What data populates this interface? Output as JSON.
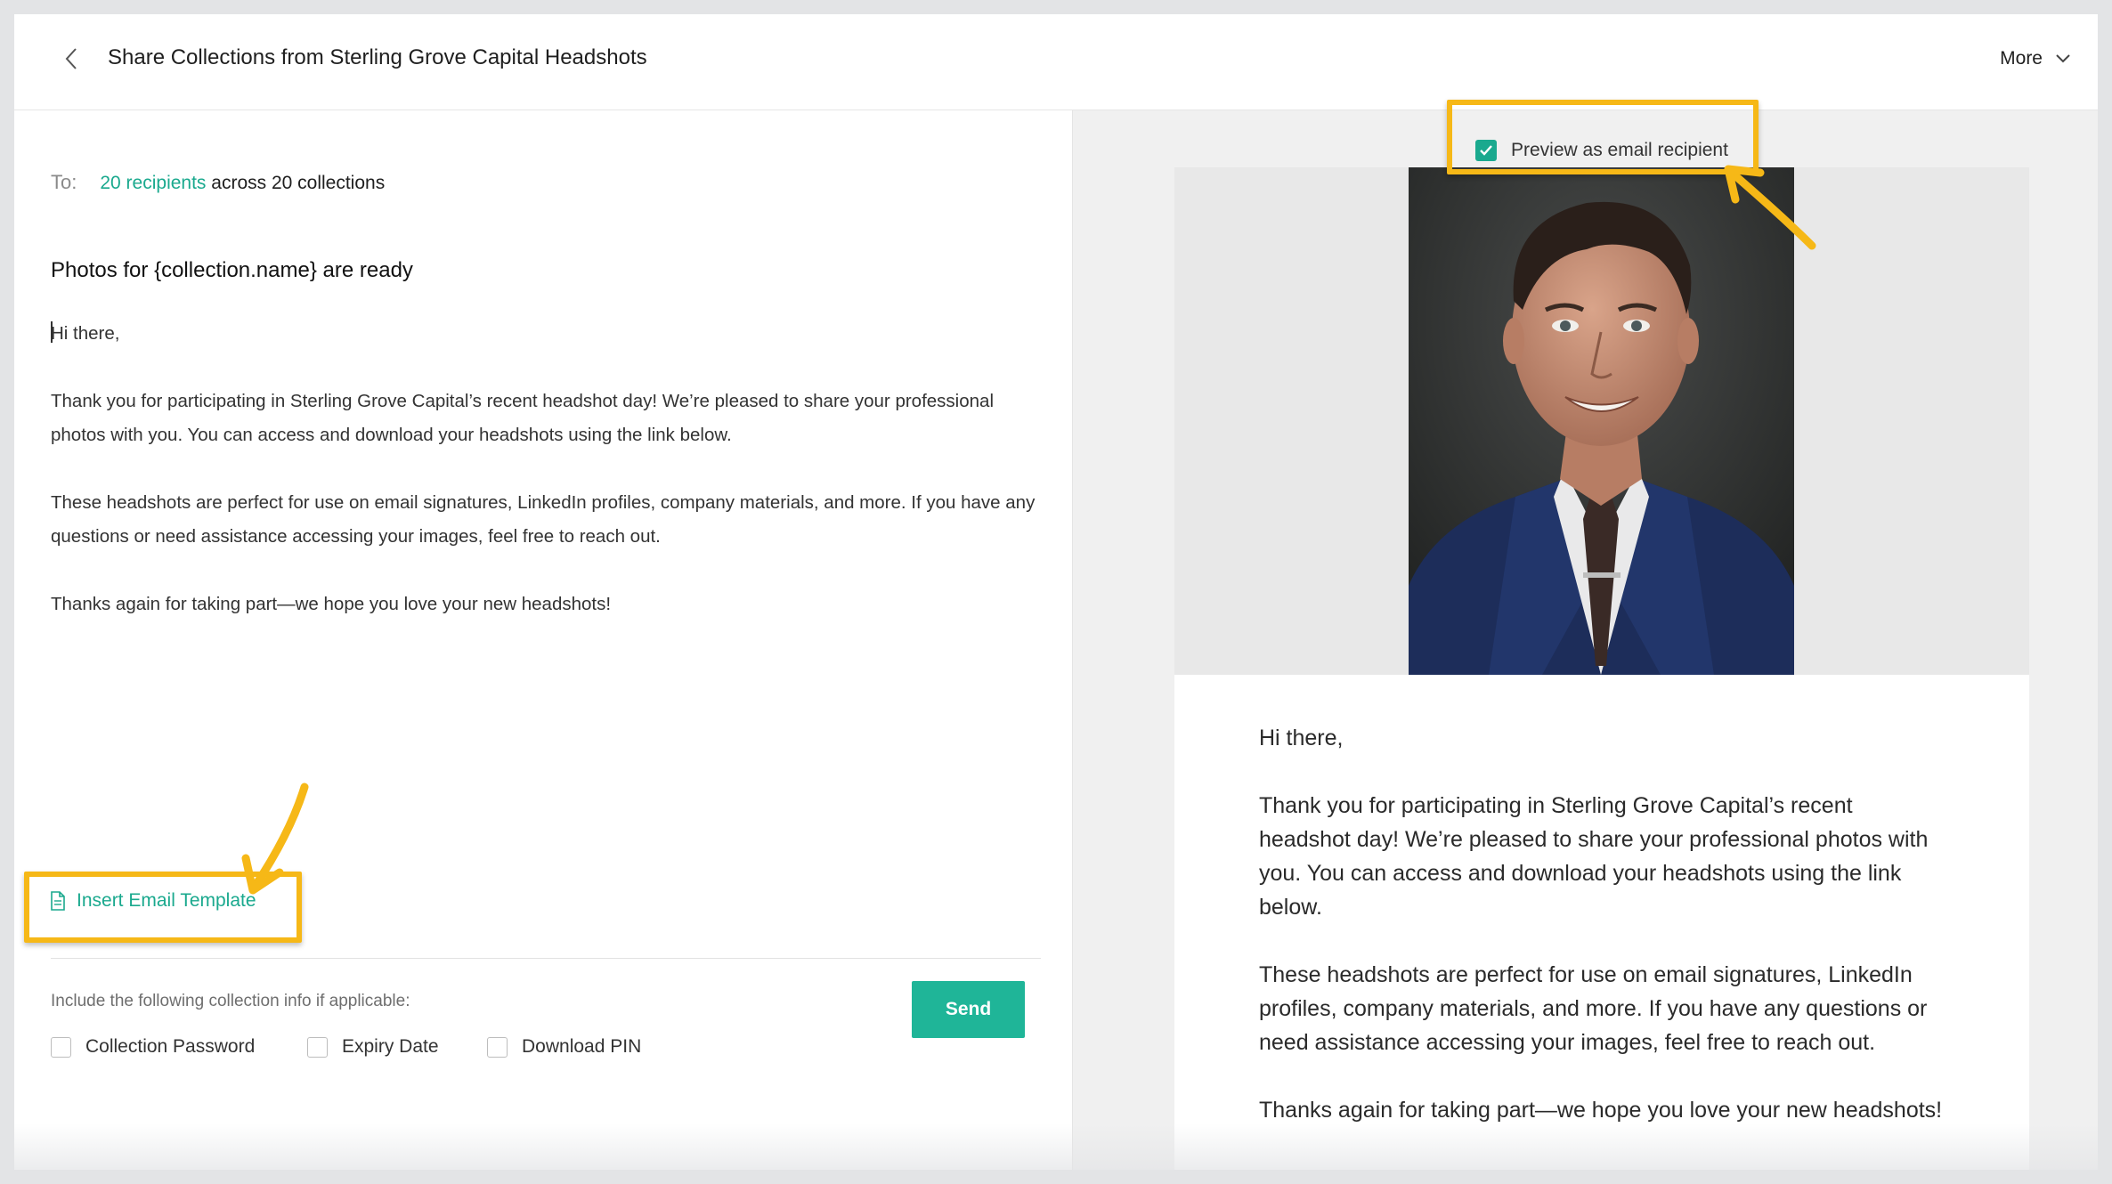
{
  "header": {
    "title": "Share Collections from Sterling Grove Capital Headshots",
    "more_label": "More"
  },
  "compose": {
    "to_label": "To:",
    "recipients_link": "20 recipients",
    "recipients_rest": "across 20 collections",
    "subject": "Photos for {collection.name} are ready",
    "body": [
      "Hi there,",
      "Thank you for participating in Sterling Grove Capital’s recent headshot day! We’re pleased to share your professional photos with you. You can access and download your headshots using the link below.",
      "These headshots are perfect for use on email signatures, LinkedIn profiles, company materials, and more. If you have any questions or need assistance accessing your images, feel free to reach out.",
      "Thanks again for taking part—we hope you love your new headshots!"
    ],
    "insert_template_label": "Insert Email Template",
    "include_label": "Include the following collection info if applicable:",
    "options": [
      {
        "label": "Collection Password",
        "checked": false
      },
      {
        "label": "Expiry Date",
        "checked": false
      },
      {
        "label": "Download PIN",
        "checked": false
      }
    ],
    "send_label": "Send"
  },
  "preview": {
    "toggle_label": "Preview as email recipient",
    "toggle_checked": true,
    "body": [
      "Hi there,",
      "Thank you for participating in Sterling Grove Capital’s recent headshot day! We’re pleased to share your professional photos with you. You can access and download your headshots using the link below.",
      "These headshots are perfect for use on email signatures, LinkedIn profiles, company materials, and more. If you have any questions or need assistance accessing your images, feel free to reach out.",
      "Thanks again for taking part—we hope you love your new headshots!"
    ]
  },
  "colors": {
    "accent": "#1aa98e",
    "send_button": "#1fb598",
    "highlight": "#f6b817"
  }
}
